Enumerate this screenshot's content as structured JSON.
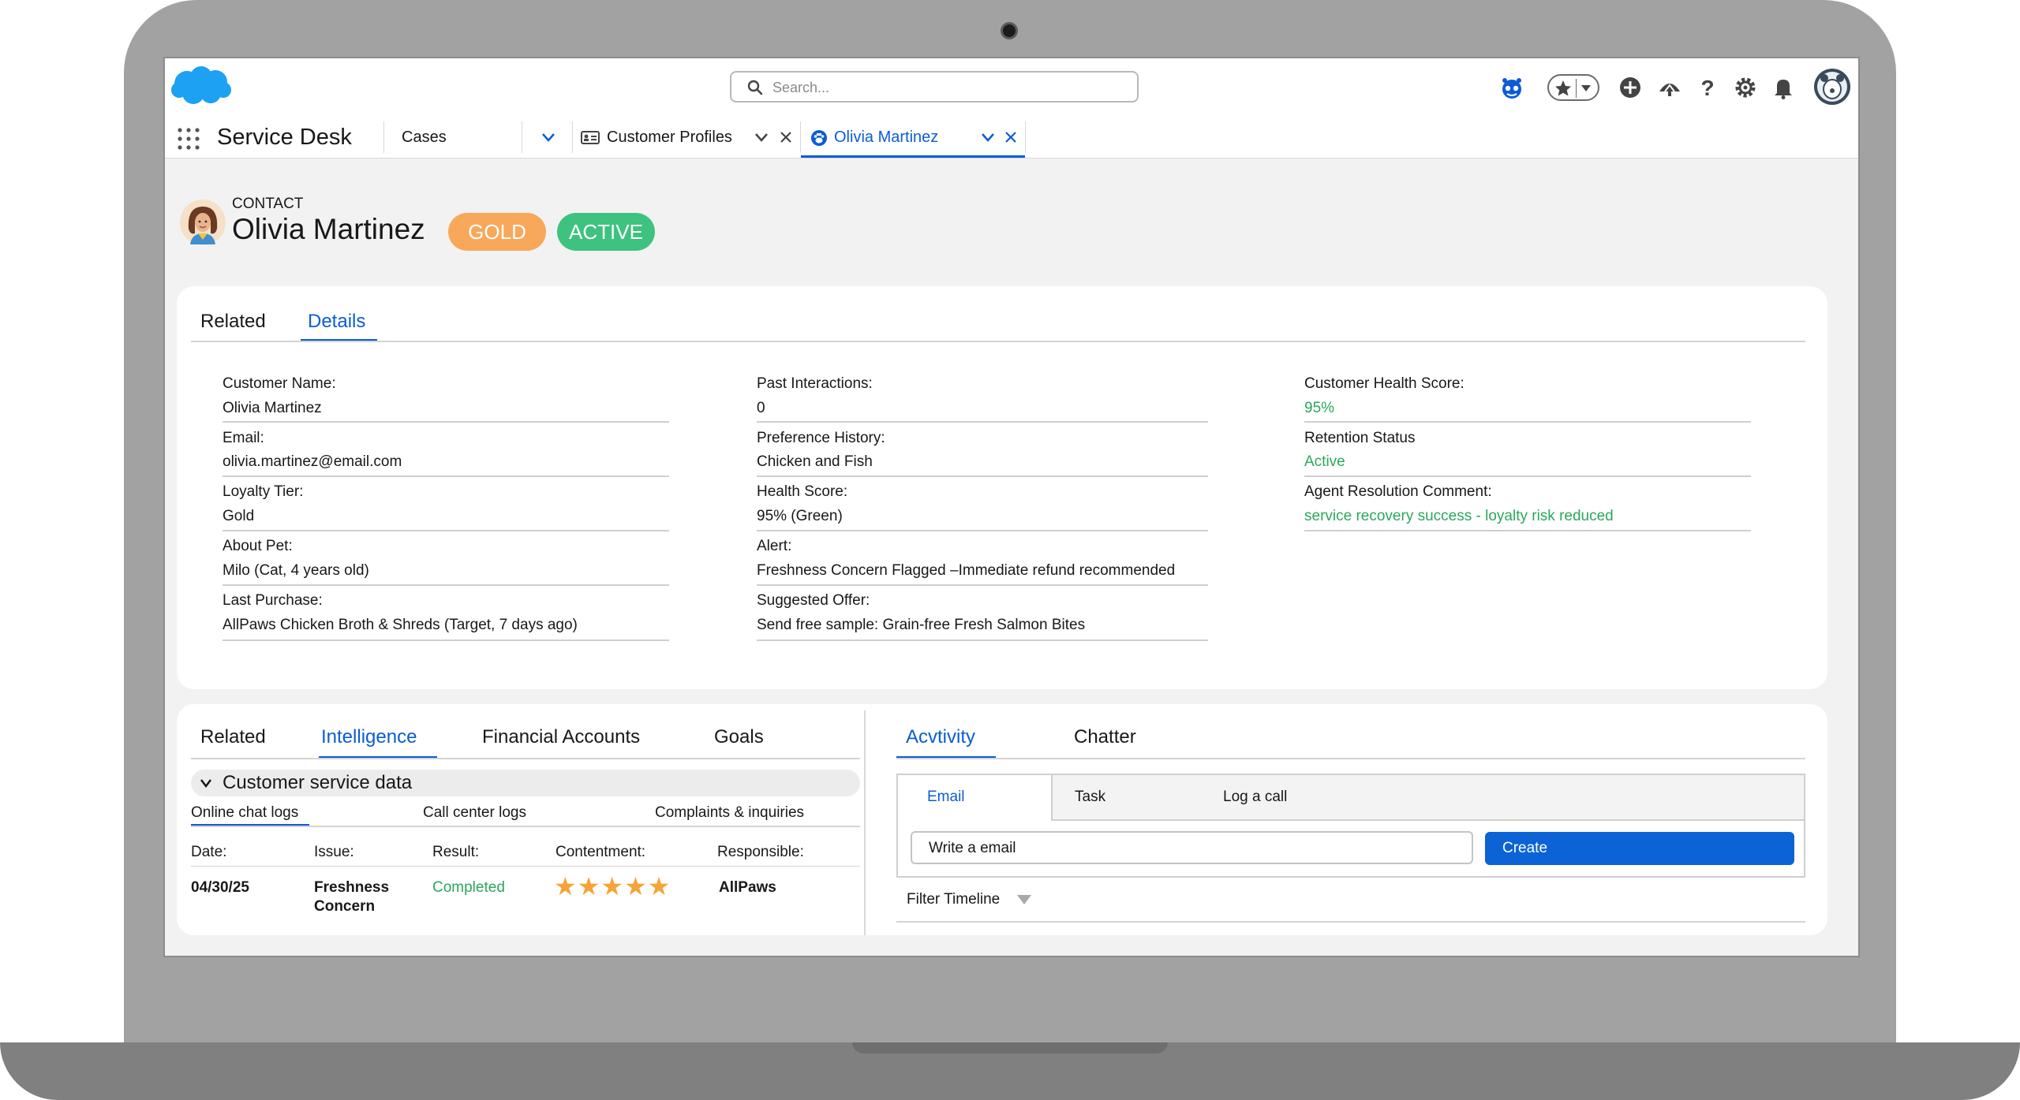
{
  "search": {
    "placeholder": "Search..."
  },
  "nav": {
    "app_name": "Service Desk",
    "tabs": [
      {
        "label": "Cases"
      },
      {
        "label": "Customer Profiles"
      },
      {
        "label": "Olivia Martinez"
      }
    ]
  },
  "record": {
    "type": "CONTACT",
    "name": "Olivia Martinez",
    "badges": [
      {
        "label": "GOLD",
        "color": "#f7a85a"
      },
      {
        "label": "ACTIVE",
        "color": "#3ec27f"
      }
    ]
  },
  "details_card": {
    "tabs": [
      "Related",
      "Details"
    ],
    "columns": [
      [
        {
          "label": "Customer Name:",
          "value": "Olivia Martinez"
        },
        {
          "label": "Email:",
          "value": "olivia.martinez@email.com"
        },
        {
          "label": "Loyalty Tier:",
          "value": "Gold"
        },
        {
          "label": "About Pet:",
          "value": "Milo (Cat, 4 years old)"
        },
        {
          "label": "Last Purchase:",
          "value": "AllPaws Chicken Broth & Shreds (Target, 7 days ago)"
        }
      ],
      [
        {
          "label": "Past Interactions:",
          "value": "0"
        },
        {
          "label": "Preference History:",
          "value": "Chicken and Fish"
        },
        {
          "label": "Health Score:",
          "value": "95% (Green)"
        },
        {
          "label": "Alert:",
          "value": "Freshness Concern Flagged –Immediate refund recommended"
        },
        {
          "label": "Suggested Offer:",
          "value": "Send free sample: Grain-free Fresh Salmon Bites"
        }
      ],
      [
        {
          "label": "Customer Health Score:",
          "value": "95%"
        },
        {
          "label": "Retention Status",
          "value": "Active"
        },
        {
          "label": "Agent Resolution Comment:",
          "value": "service recovery success - loyalty risk reduced"
        }
      ]
    ]
  },
  "intel_card": {
    "tabs": [
      "Related",
      "Intelligence",
      "Financial Accounts",
      "Goals"
    ],
    "section_title": "Customer service data",
    "subtabs": [
      "Online chat logs",
      "Call center logs",
      "Complaints & inquiries"
    ],
    "table": {
      "headers": [
        "Date:",
        "Issue:",
        "Result:",
        "Contentment:",
        "Responsible:"
      ],
      "rows": [
        {
          "date": "04/30/25",
          "issue_line1": "Freshness",
          "issue_line2": "Concern",
          "result": "Completed",
          "rating": 5,
          "responsible": "AllPaws"
        }
      ]
    }
  },
  "activity_card": {
    "tabs": [
      "Acvtivity",
      "Chatter"
    ],
    "subtabs": [
      "Email",
      "Task",
      "Log a call"
    ],
    "email_placeholder": "Write a email",
    "create_label": "Create",
    "filter_label": "Filter Timeline"
  },
  "colors": {
    "accent": "#0b5cd5",
    "success": "#2aa85a",
    "star": "#f5a43a"
  }
}
